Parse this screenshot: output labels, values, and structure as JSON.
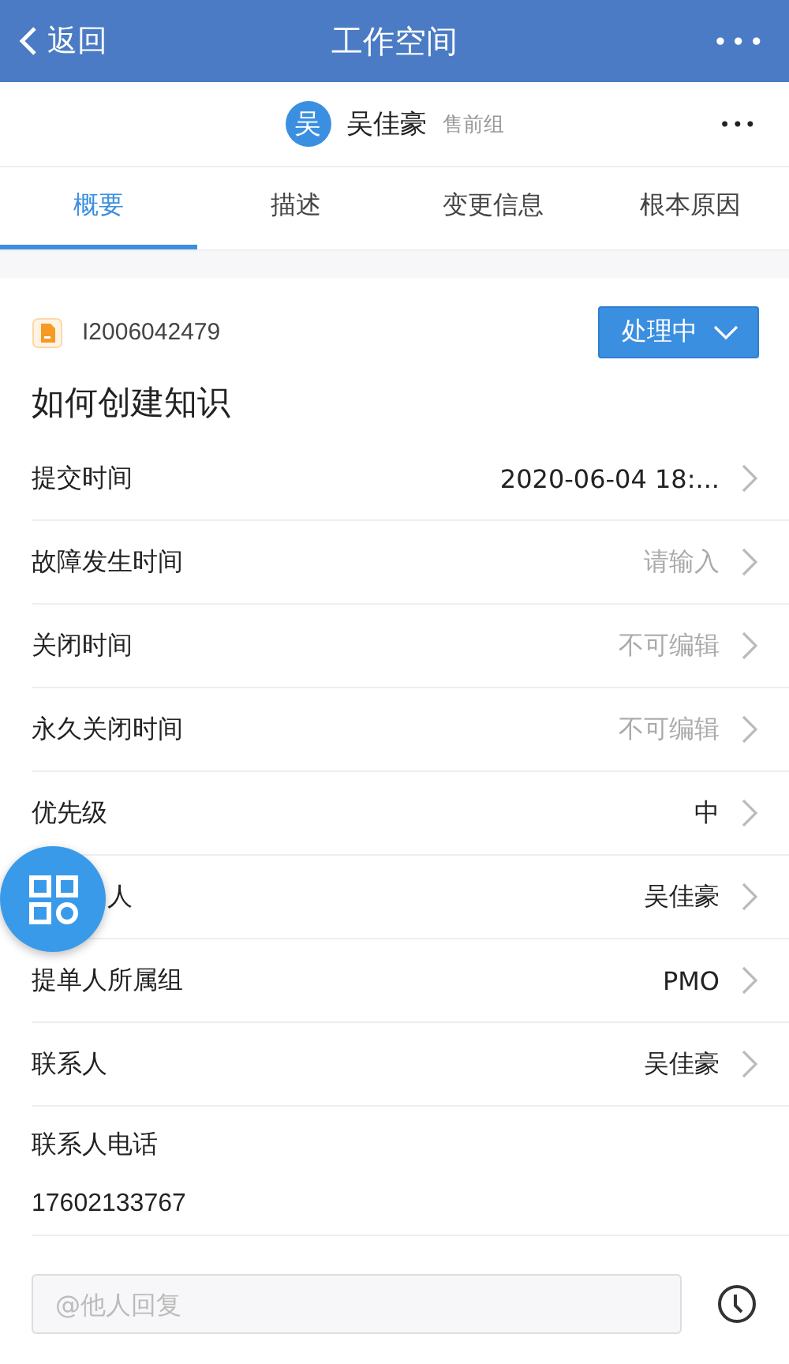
{
  "header": {
    "back": "返回",
    "title": "工作空间",
    "more": "•••"
  },
  "user": {
    "avatar": "吴",
    "name": "吴佳豪",
    "group": "售前组",
    "more": "•••"
  },
  "tabs": [
    {
      "label": "概要",
      "selected": true
    },
    {
      "label": "描述",
      "selected": false
    },
    {
      "label": "变更信息",
      "selected": false
    },
    {
      "label": "根本原因",
      "selected": false
    }
  ],
  "ticket": {
    "id": "I2006042479",
    "status": "处理中",
    "title": "如何创建知识"
  },
  "fields": [
    {
      "label": "提交时间",
      "value": "2020-06-04 18:...",
      "kind": "text"
    },
    {
      "label": "故障发生时间",
      "placeholder": "请输入",
      "kind": "empty"
    },
    {
      "label": "关闭时间",
      "value": "不可编辑",
      "kind": "disabled"
    },
    {
      "label": "永久关闭时间",
      "value": "不可编辑",
      "kind": "disabled"
    },
    {
      "label": "优先级",
      "value": "中",
      "kind": "text"
    },
    {
      "label": "人",
      "value": "吴佳豪",
      "kind": "text"
    },
    {
      "label": "提单人所属组",
      "value": "PMO",
      "kind": "text"
    },
    {
      "label": "联系人",
      "value": "吴佳豪",
      "kind": "text"
    },
    {
      "label": "联系人电话",
      "value": "17602133767",
      "kind": "block"
    }
  ],
  "reply": {
    "placeholder": "@他人回复"
  }
}
